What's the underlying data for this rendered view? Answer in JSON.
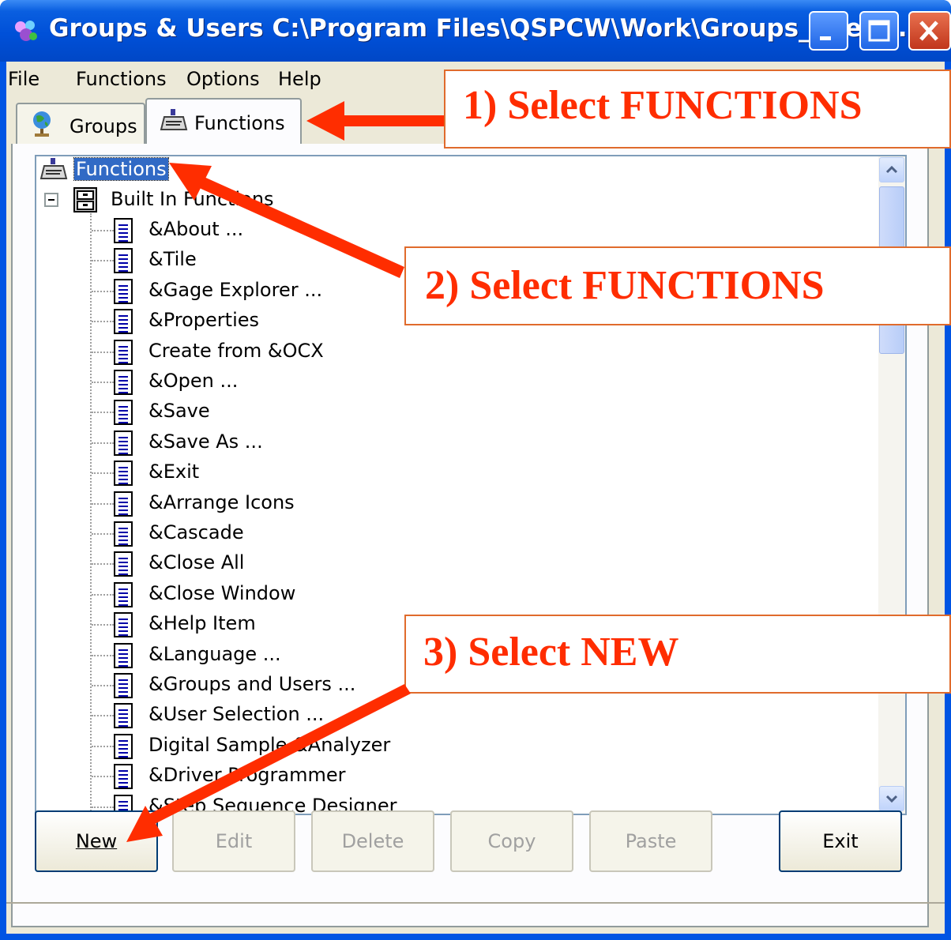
{
  "window": {
    "title": "Groups & Users C:\\Program Files\\QSPCW\\Work\\Groups_Users....",
    "icon": "app-icon"
  },
  "menu": [
    "File",
    "Functions",
    "Options",
    "Help"
  ],
  "tabs": [
    {
      "label": "Groups",
      "icon": "globe-icon",
      "active": false
    },
    {
      "label": "Functions",
      "icon": "functions-icon",
      "active": true
    }
  ],
  "tree": {
    "root": "Functions",
    "group": "Built In Functions",
    "items": [
      "&About ...",
      "&Tile",
      "&Gage Explorer ...",
      "&Properties",
      "Create from &OCX",
      "&Open ...",
      "&Save",
      "&Save As ...",
      "&Exit",
      "&Arrange Icons",
      "&Cascade",
      "&Close All",
      "&Close Window",
      "&Help Item",
      "&Language ...",
      "&Groups and Users ...",
      "&User Selection ...",
      "Digital Sample &Analyzer",
      "&Driver Programmer",
      "&Step Sequence Designer"
    ]
  },
  "buttons": {
    "new": "New",
    "edit": "Edit",
    "delete": "Delete",
    "copy": "Copy",
    "paste": "Paste",
    "exit": "Exit"
  },
  "annotations": {
    "step1": "1) Select FUNCTIONS",
    "step2": "2) Select FUNCTIONS",
    "step3": "3) Select NEW",
    "color": "#ff2d00"
  }
}
